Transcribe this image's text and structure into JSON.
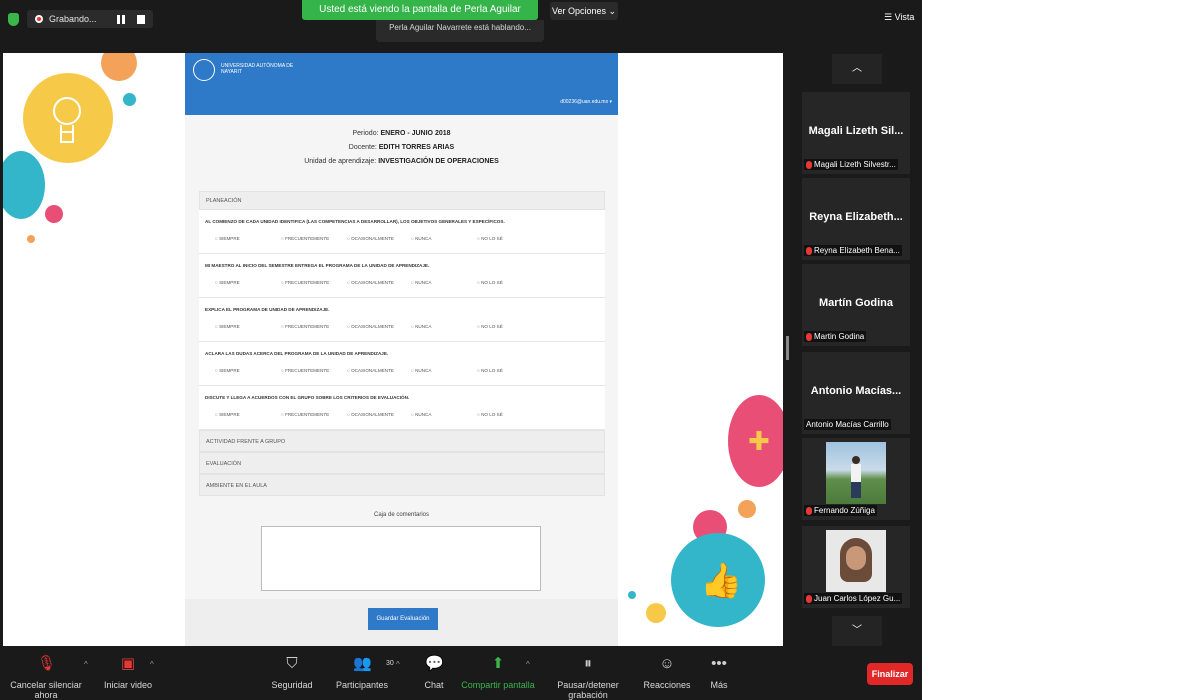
{
  "topbar": {
    "recording_label": "Grabando...",
    "share_banner": "Usted está viendo la pantalla de Perla Aguilar Navarrete",
    "share_sub": "Perla Aguilar Navarrete está hablando...",
    "view_options": "Ver Opciones",
    "view_label": "Vista"
  },
  "form": {
    "university": "UNIVERSIDAD AUTÓNOMA DE NAYARIT",
    "email": "d00236@uan.edu.mx",
    "period_label": "Periodo:",
    "period_value": "ENERO - JUNIO 2018",
    "teacher_label": "Docente:",
    "teacher_value": "EDITH TORRES ARIAS",
    "unit_label": "Unidad de aprendizaje:",
    "unit_value": "INVESTIGACIÓN DE OPERACIONES",
    "sections": [
      {
        "label": "PLANEACIÓN"
      },
      {
        "label": "ACTIVIDAD FRENTE A GRUPO"
      },
      {
        "label": "EVALUACIÓN"
      },
      {
        "label": "AMBIENTE EN EL AULA"
      }
    ],
    "options": [
      "SIEMPRE",
      "FRECUENTEMENTE",
      "OCASIONALMENTE",
      "NUNCA",
      "NO LO SÉ"
    ],
    "questions": [
      {
        "text": "AL COMIENZO DE CADA UNIDAD IDENTIFICA (LAS COMPETENCIAS A DESARROLLAR), LOS OBJETIVOS GENERALES Y ESPECÍFICOS."
      },
      {
        "text": "MI MAESTRO AL INICIO DEL SEMESTRE ENTREGA EL PROGRAMA DE LA UNIDAD DE APRENDIZAJE."
      },
      {
        "text": "EXPLICA EL PROGRAMA DE UNIDAD DE APRENDIZAJE."
      },
      {
        "text": "ACLARA LAS DUDAS ACERCA DEL PROGRAMA DE LA UNIDAD DE APRENDIZAJE."
      },
      {
        "text": "DISCUTE Y LLEGA A ACUERDOS CON EL GRUPO SOBRE LOS CRITERIOS DE EVALUACIÓN."
      }
    ],
    "comments_label": "Caja de comentarios",
    "save_button": "Guardar Evaluación"
  },
  "participants": [
    {
      "title": "Magali Lizeth Sil...",
      "label": "Magali Lizeth Silvestr..."
    },
    {
      "title": "Reyna Elizabeth...",
      "label": "Reyna Elizabeth Bena..."
    },
    {
      "title": "Martín Godina",
      "label": "Martin Godina"
    },
    {
      "title": "Antonio Macías...",
      "label": "Antonio Macías Carrillo"
    },
    {
      "title": "",
      "label": "Fernando Zúñiga"
    },
    {
      "title": "",
      "label": "Juan Carlos López Gu..."
    }
  ],
  "toolbar": {
    "mute": "Cancelar silenciar ahora",
    "video": "Iniciar video",
    "security": "Seguridad",
    "participants": "Participantes",
    "participants_count": "30",
    "chat": "Chat",
    "share": "Compartir pantalla",
    "record": "Pausar/detener grabación",
    "reactions": "Reacciones",
    "more": "Más",
    "finalize": "Finalizar"
  },
  "colors": {
    "accent_green": "#35b44a",
    "form_blue": "#2f79c9",
    "end_red": "#e02828"
  }
}
